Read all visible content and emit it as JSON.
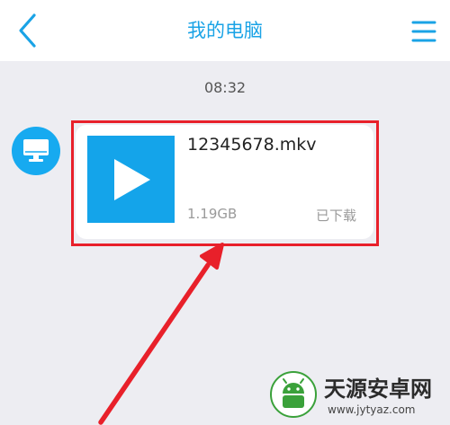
{
  "header": {
    "title": "我的电脑",
    "back_icon": "chevron-left-icon",
    "menu_icon": "hamburger-menu-icon"
  },
  "chat": {
    "timestamp": "08:32",
    "sender_icon": "computer-monitor-icon",
    "file": {
      "name": "12345678.mkv",
      "size": "1.19GB",
      "status": "已下载",
      "thumbnail_icon": "video-play-icon"
    }
  },
  "annotation": {
    "highlight_color": "#e8202a"
  },
  "watermark": {
    "title": "天源安卓网",
    "url": "www.jytyaz.com"
  },
  "colors": {
    "accent": "#1aa3e6",
    "background": "#ededf2",
    "card": "#ffffff"
  }
}
